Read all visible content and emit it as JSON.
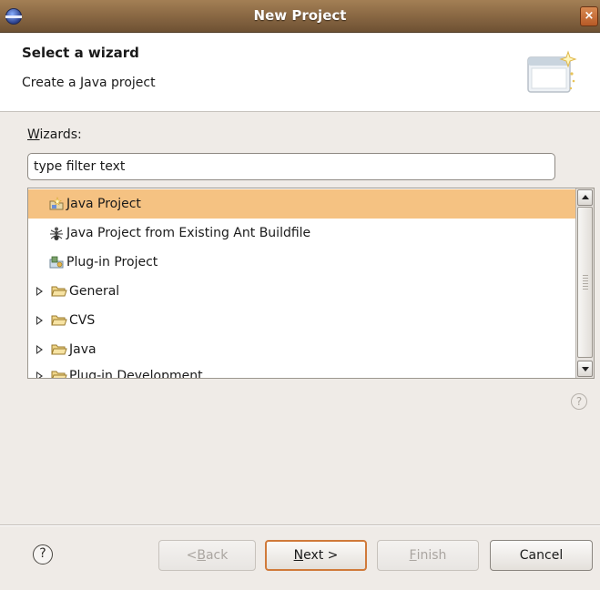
{
  "window": {
    "title": "New Project",
    "close_glyph": "×",
    "app_icon": "eclipse-icon"
  },
  "banner": {
    "title": "Select a wizard",
    "description": "Create a Java project",
    "graphic_icon": "new-wizard-graphic-icon"
  },
  "filter": {
    "label_mnemonic": "W",
    "label_rest": "izards:",
    "value": "type filter text"
  },
  "tree": {
    "items": [
      {
        "label": "Java Project",
        "icon": "java-project-icon",
        "selected": true
      },
      {
        "label": "Java Project from Existing Ant Buildfile",
        "icon": "ant-icon",
        "selected": false
      },
      {
        "label": "Plug-in Project",
        "icon": "plugin-project-icon",
        "selected": false
      },
      {
        "label": "General",
        "icon": "folder-icon",
        "expandable": true
      },
      {
        "label": "CVS",
        "icon": "folder-icon",
        "expandable": true
      },
      {
        "label": "Java",
        "icon": "folder-icon",
        "expandable": true
      },
      {
        "label": "Plug-in Development",
        "icon": "folder-icon",
        "expandable": true
      }
    ]
  },
  "help_glyph": "?",
  "buttons": {
    "back_prefix": "< ",
    "back_mnemonic": "B",
    "back_rest": "ack",
    "next_mnemonic": "N",
    "next_rest": "ext >",
    "finish_mnemonic": "F",
    "finish_rest": "inish",
    "cancel": "Cancel"
  },
  "colors": {
    "selection": "#f5c282",
    "title_bar": "#8c6a45",
    "default_button_border": "#d07a3a"
  }
}
